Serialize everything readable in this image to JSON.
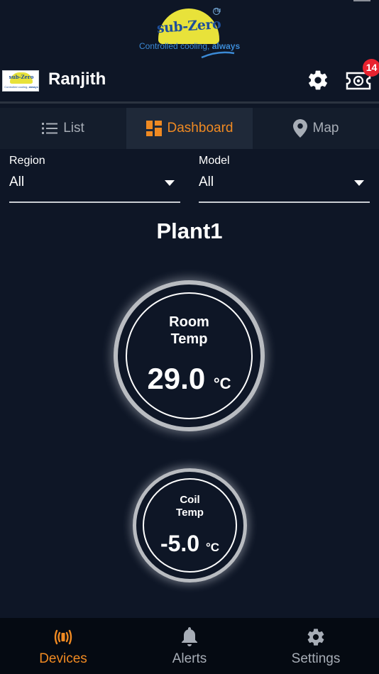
{
  "brand": {
    "name": "sub-Zero",
    "tagline_prefix": "Controlled cooling,",
    "tagline_emphasis": "always",
    "trademark": "TM"
  },
  "user": {
    "name": "Ranjith",
    "notification_count": "14"
  },
  "tabs": [
    {
      "label": "List",
      "icon": "list-icon",
      "active": false
    },
    {
      "label": "Dashboard",
      "icon": "dashboard-icon",
      "active": true
    },
    {
      "label": "Map",
      "icon": "map-pin-icon",
      "active": false
    }
  ],
  "filters": {
    "region": {
      "label": "Region",
      "value": "All"
    },
    "model": {
      "label": "Model",
      "value": "All"
    }
  },
  "plant": {
    "name": "Plant1",
    "room": {
      "label_line1": "Room",
      "label_line2": "Temp",
      "value": "29.0",
      "unit": "°C"
    },
    "coil": {
      "label_line1": "Coil",
      "label_line2": "Temp",
      "value": "-5.0",
      "unit": "°C"
    }
  },
  "nav": [
    {
      "label": "Devices",
      "icon": "devices-signal-icon",
      "active": true
    },
    {
      "label": "Alerts",
      "icon": "bell-icon",
      "active": false
    },
    {
      "label": "Settings",
      "icon": "gear-icon",
      "active": false
    }
  ],
  "colors": {
    "background": "#0e1626",
    "accent": "#f08a22",
    "tab_bar": "#141d2c",
    "tab_active": "#1f2939",
    "badge": "#e8232f",
    "nav_bar": "#050a12"
  }
}
